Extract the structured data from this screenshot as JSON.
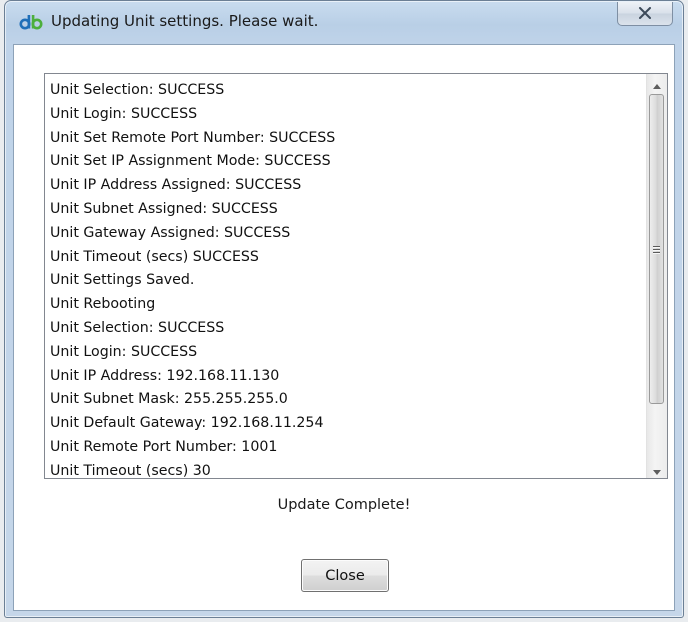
{
  "window": {
    "title": "Updating Unit settings.  Please wait.",
    "app_icon": "db-logo-icon",
    "close_icon": "close-x-icon"
  },
  "log": {
    "lines": [
      "Unit Selection: SUCCESS",
      "Unit Login: SUCCESS",
      "Unit Set Remote Port Number: SUCCESS",
      "Unit Set IP Assignment Mode: SUCCESS",
      "Unit IP Address Assigned: SUCCESS",
      "Unit Subnet Assigned: SUCCESS",
      "Unit Gateway Assigned: SUCCESS",
      "Unit Timeout (secs) SUCCESS",
      "Unit Settings Saved.",
      "Unit Rebooting",
      "Unit Selection: SUCCESS",
      "Unit Login: SUCCESS",
      "Unit IP Address: 192.168.11.130",
      "Unit Subnet Mask: 255.255.255.0",
      "Unit Default Gateway: 192.168.11.254",
      "Unit Remote Port Number: 1001",
      "Unit Timeout (secs) 30"
    ]
  },
  "status": {
    "message": "Update Complete!"
  },
  "buttons": {
    "close_label": "Close"
  },
  "colors": {
    "logo_blue": "#1f6fb8",
    "logo_green": "#4caf3c",
    "title_bar": "#bfd3e9"
  }
}
